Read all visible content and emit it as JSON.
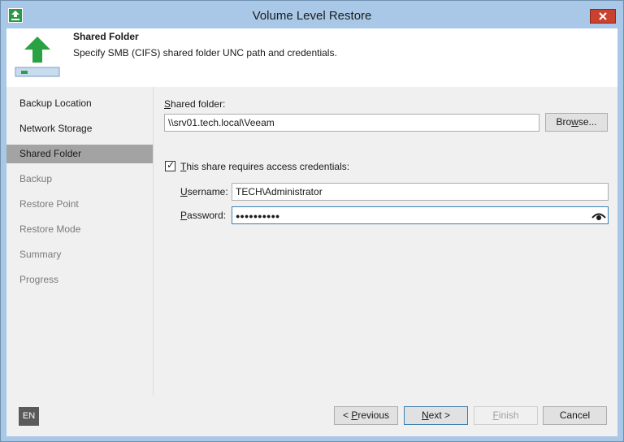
{
  "window": {
    "title": "Volume Level Restore",
    "icon": "app-icon",
    "close_icon": "close-icon"
  },
  "header": {
    "title": "Shared Folder",
    "description": "Specify SMB (CIFS) shared folder UNC path and credentials.",
    "icon": "upload-arrow-icon",
    "accent": "#2aa142"
  },
  "steps": [
    {
      "label": "Backup Location",
      "state": "done"
    },
    {
      "label": "Network Storage",
      "state": "done"
    },
    {
      "label": "Shared Folder",
      "state": "active"
    },
    {
      "label": "Backup",
      "state": "disabled"
    },
    {
      "label": "Restore Point",
      "state": "disabled"
    },
    {
      "label": "Restore Mode",
      "state": "disabled"
    },
    {
      "label": "Summary",
      "state": "disabled"
    },
    {
      "label": "Progress",
      "state": "disabled"
    }
  ],
  "form": {
    "shared_folder_label_key": "S",
    "shared_folder_label_rest": "hared folder:",
    "shared_folder_value": "\\\\srv01.tech.local\\Veeam",
    "browse_key": "w",
    "browse_pre": "Bro",
    "browse_post": "se...",
    "credentials_checked": true,
    "credentials_key": "T",
    "credentials_rest": "his share requires access credentials:",
    "username_key": "U",
    "username_rest": "sername:",
    "username_value": "TECH\\Administrator",
    "password_key": "P",
    "password_rest": "assword:",
    "password_value": "●●●●●●●●●●",
    "reveal_icon": "eye-icon"
  },
  "footer": {
    "language": "EN",
    "previous_pre": "< ",
    "previous_key": "P",
    "previous_rest": "revious",
    "next_key": "N",
    "next_rest": "ext >",
    "finish_key": "F",
    "finish_rest": "inish",
    "cancel": "Cancel"
  }
}
